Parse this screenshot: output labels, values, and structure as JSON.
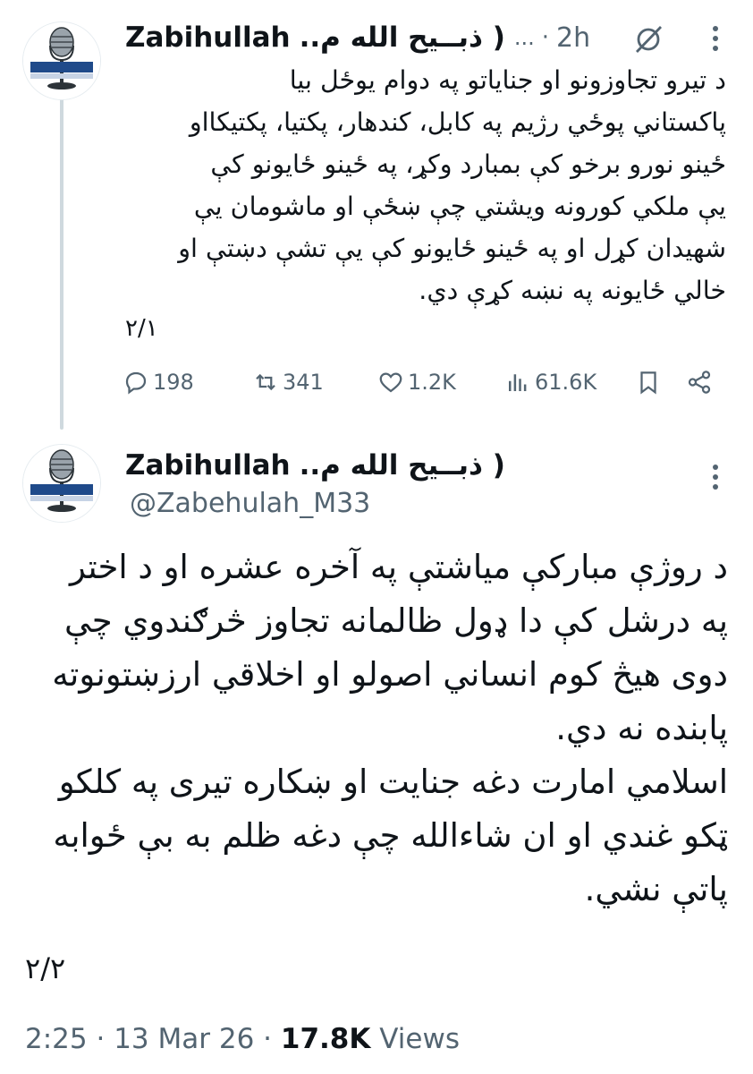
{
  "tweet1": {
    "author_name": "Zabihullah",
    "author_name_rtl": "( ذبــیح الله م..",
    "truncation": "...",
    "time": "2h",
    "text_lines": [
      "د تیرو تجاوزونو او جنایاتو په دوام یوځل بیا",
      "پاکستاني پوځي رژیم په کابل، کندهار، پکتیا، پکتیکااو",
      "ځینو نورو برخو کې بمبارد وکړ، په ځینو ځایونو کې",
      "یې ملکي کورونه ویشتي چې ښځې او ماشومان یې",
      "شهیدان کړل او په ځینو ځایونو کې یې تشې دښتې او",
      "خالي ځایونه په نښه کړې دي."
    ],
    "counter": "۲/۱",
    "actions": {
      "replies": "198",
      "reposts": "341",
      "likes": "1.2K",
      "views": "61.6K"
    }
  },
  "tweet2": {
    "author_name": "Zabihullah",
    "author_name_rtl": "( ذبــیح الله م..",
    "handle": "@Zabehulah_M33",
    "text_lines": [
      "د روژې مبارکې میاشتې په آخره عشره او د اختر",
      "په درشل کې دا ډول ظالمانه تجاوز څرګندوي چې",
      "دوی هیڅ کوم انساني اصولو او اخلاقي ارزښتونوته",
      "پابنده نه دي.",
      "اسلامي امارت دغه جنایت او ښکاره تیری په کلکو",
      "ټکو غندي او ان شاءالله چې دغه ظلم به بې ځوابه",
      "پاتې نشي."
    ],
    "counter": "۲/۲",
    "footer": {
      "time": "2:25",
      "date": "13 Mar 26",
      "views_count": "17.8K",
      "views_label": "Views"
    }
  },
  "icons": [
    "microphone-avatar",
    "grok-icon",
    "more-icon",
    "reply-icon",
    "repost-icon",
    "like-icon",
    "views-icon",
    "bookmark-icon",
    "share-icon"
  ],
  "colors": {
    "text": "#0f1419",
    "secondary": "#536471",
    "thread_line": "#cfd9de",
    "avatar_banner": "#1f4a8a"
  }
}
